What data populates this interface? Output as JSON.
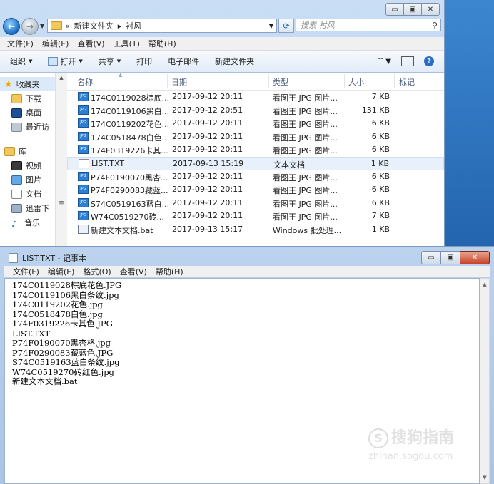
{
  "explorer": {
    "address": {
      "parts": [
        "«",
        "新建文件夹",
        "▸",
        "衬风"
      ]
    },
    "search_placeholder": "搜索 衬风",
    "menu": [
      "文件(F)",
      "编辑(E)",
      "查看(V)",
      "工具(T)",
      "帮助(H)"
    ],
    "toolbar": [
      "组织",
      "打开",
      "共享",
      "打印",
      "电子邮件",
      "新建文件夹"
    ],
    "nav": {
      "favorites": "收藏夹",
      "fav_items": [
        "下载",
        "桌面",
        "最近访"
      ],
      "libraries": "库",
      "lib_items": [
        "视频",
        "图片",
        "文档",
        "迅雷下",
        "音乐"
      ]
    },
    "columns": [
      "名称",
      "日期",
      "类型",
      "大小",
      "标记"
    ],
    "files": [
      {
        "name": "174C0119028棕底...",
        "date": "2017-09-12 20:11",
        "type": "看图王 JPG 图片...",
        "size": "7 KB",
        "icon": "jpg-icon"
      },
      {
        "name": "174C0119106黑白...",
        "date": "2017-09-12 20:51",
        "type": "看图王 JPG 图片...",
        "size": "131 KB",
        "icon": "jpg-icon"
      },
      {
        "name": "174C0119202花色...",
        "date": "2017-09-12 20:11",
        "type": "看图王 JPG 图片...",
        "size": "6 KB",
        "icon": "jpg-icon"
      },
      {
        "name": "174C0518478白色...",
        "date": "2017-09-12 20:11",
        "type": "看图王 JPG 图片...",
        "size": "6 KB",
        "icon": "jpg-icon"
      },
      {
        "name": "174F0319226卡其...",
        "date": "2017-09-12 20:11",
        "type": "看图王 JPG 图片...",
        "size": "6 KB",
        "icon": "jpg-icon"
      },
      {
        "name": "LIST.TXT",
        "date": "2017-09-13 15:19",
        "type": "文本文档",
        "size": "1 KB",
        "icon": "txt-icon"
      },
      {
        "name": "P74F0190070黑杏...",
        "date": "2017-09-12 20:11",
        "type": "看图王 JPG 图片...",
        "size": "6 KB",
        "icon": "jpg-icon"
      },
      {
        "name": "P74F0290083藏蓝...",
        "date": "2017-09-12 20:11",
        "type": "看图王 JPG 图片...",
        "size": "6 KB",
        "icon": "jpg-icon"
      },
      {
        "name": "S74C0519163蓝白...",
        "date": "2017-09-12 20:11",
        "type": "看图王 JPG 图片...",
        "size": "6 KB",
        "icon": "jpg-icon"
      },
      {
        "name": "W74C0519270砖...",
        "date": "2017-09-12 20:11",
        "type": "看图王 JPG 图片...",
        "size": "7 KB",
        "icon": "jpg-icon"
      },
      {
        "name": "新建文本文档.bat",
        "date": "2017-09-13 15:17",
        "type": "Windows 批处理...",
        "size": "1 KB",
        "icon": "bat-icon"
      }
    ]
  },
  "notepad": {
    "title": "LIST.TXT - 记事本",
    "menu": [
      "文件(F)",
      "编辑(E)",
      "格式(O)",
      "查看(V)",
      "帮助(H)"
    ],
    "lines": [
      "174C0119028棕底花色.JPG",
      "174C0119106黑白条纹.jpg",
      "174C0119202花色.jpg",
      "174C0518478白色.jpg",
      "174F0319226卡其色.JPG",
      "LIST.TXT",
      "P74F0190070黑杏格.jpg",
      "P74F0290083藏蓝色.JPG",
      "S74C0519163蓝白条纹.jpg",
      "W74C0519270砖红色.jpg",
      "新建文本文档.bat"
    ]
  },
  "watermark": {
    "brand": "搜狗指南",
    "url": "zhinan.sogou.com"
  }
}
